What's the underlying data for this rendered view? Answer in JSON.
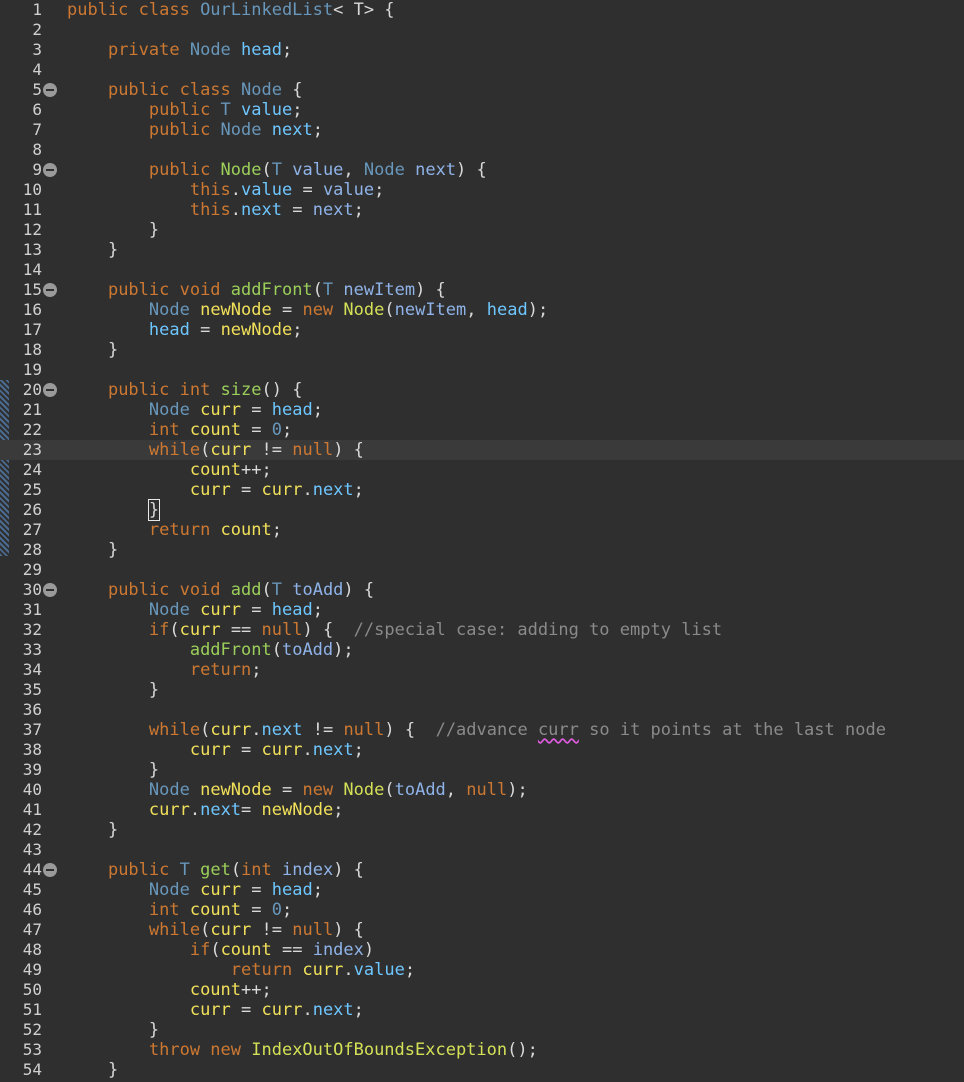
{
  "colors": {
    "background": "#2f2f2f",
    "current_line": "#3a3a3a",
    "keyword": "#cc7832",
    "type": "#6897bb",
    "field": "#6ec6ff",
    "local_var": "#f1e05a",
    "parameter": "#8fb3e8",
    "method": "#9bcf5a",
    "constructor_class": "#d4e157",
    "comment": "#8a8a8a",
    "plain": "#d9d9d9",
    "line_number": "#d0d0d0"
  },
  "icons": {
    "fold": "collapse-fold-icon",
    "change_bar": "change-marker"
  },
  "current_line": 23,
  "fold_lines": [
    5,
    9,
    15,
    20,
    30,
    44
  ],
  "lines": [
    {
      "n": "1",
      "t": [
        [
          "kw",
          "public class "
        ],
        [
          "ty",
          "OurLinkedList"
        ],
        [
          "pl",
          "< T> {"
        ]
      ]
    },
    {
      "n": "2",
      "t": []
    },
    {
      "n": "3",
      "t": [
        [
          "pl",
          "    "
        ],
        [
          "kw",
          "private "
        ],
        [
          "ty",
          "Node "
        ],
        [
          "fd",
          "head"
        ],
        [
          "pl",
          ";"
        ]
      ]
    },
    {
      "n": "4",
      "t": []
    },
    {
      "n": "5",
      "t": [
        [
          "pl",
          "    "
        ],
        [
          "kw",
          "public class "
        ],
        [
          "ty",
          "Node "
        ],
        [
          "pl",
          "{"
        ]
      ]
    },
    {
      "n": "6",
      "t": [
        [
          "pl",
          "        "
        ],
        [
          "kw",
          "public "
        ],
        [
          "ty",
          "T "
        ],
        [
          "fd",
          "value"
        ],
        [
          "pl",
          ";"
        ]
      ]
    },
    {
      "n": "7",
      "t": [
        [
          "pl",
          "        "
        ],
        [
          "kw",
          "public "
        ],
        [
          "ty",
          "Node "
        ],
        [
          "fd",
          "next"
        ],
        [
          "pl",
          ";"
        ]
      ]
    },
    {
      "n": "8",
      "t": []
    },
    {
      "n": "9",
      "t": [
        [
          "pl",
          "        "
        ],
        [
          "kw",
          "public "
        ],
        [
          "mt",
          "Node"
        ],
        [
          "pl",
          "("
        ],
        [
          "ty",
          "T "
        ],
        [
          "pa",
          "value"
        ],
        [
          "pl",
          ", "
        ],
        [
          "ty",
          "Node "
        ],
        [
          "pa",
          "next"
        ],
        [
          "pl",
          ") {"
        ]
      ]
    },
    {
      "n": "10",
      "t": [
        [
          "pl",
          "            "
        ],
        [
          "kw",
          "this"
        ],
        [
          "pl",
          "."
        ],
        [
          "fd",
          "value"
        ],
        [
          "pl",
          " = "
        ],
        [
          "pa",
          "value"
        ],
        [
          "pl",
          ";"
        ]
      ]
    },
    {
      "n": "11",
      "t": [
        [
          "pl",
          "            "
        ],
        [
          "kw",
          "this"
        ],
        [
          "pl",
          "."
        ],
        [
          "fd",
          "next"
        ],
        [
          "pl",
          " = "
        ],
        [
          "pa",
          "next"
        ],
        [
          "pl",
          ";"
        ]
      ]
    },
    {
      "n": "12",
      "t": [
        [
          "pl",
          "        }"
        ]
      ]
    },
    {
      "n": "13",
      "t": [
        [
          "pl",
          "    }"
        ]
      ]
    },
    {
      "n": "14",
      "t": []
    },
    {
      "n": "15",
      "t": [
        [
          "pl",
          "    "
        ],
        [
          "kw",
          "public void "
        ],
        [
          "mt",
          "addFront"
        ],
        [
          "pl",
          "("
        ],
        [
          "ty",
          "T "
        ],
        [
          "pa",
          "newItem"
        ],
        [
          "pl",
          ") {"
        ]
      ]
    },
    {
      "n": "16",
      "t": [
        [
          "pl",
          "        "
        ],
        [
          "ty",
          "Node "
        ],
        [
          "lv",
          "newNode"
        ],
        [
          "pl",
          " = "
        ],
        [
          "kw",
          "new "
        ],
        [
          "cl",
          "Node"
        ],
        [
          "pl",
          "("
        ],
        [
          "pa",
          "newItem"
        ],
        [
          "pl",
          ", "
        ],
        [
          "fd",
          "head"
        ],
        [
          "pl",
          ");"
        ]
      ]
    },
    {
      "n": "17",
      "t": [
        [
          "pl",
          "        "
        ],
        [
          "fd",
          "head"
        ],
        [
          "pl",
          " = "
        ],
        [
          "lv",
          "newNode"
        ],
        [
          "pl",
          ";"
        ]
      ]
    },
    {
      "n": "18",
      "t": [
        [
          "pl",
          "    }"
        ]
      ]
    },
    {
      "n": "19",
      "t": []
    },
    {
      "n": "20",
      "t": [
        [
          "pl",
          "    "
        ],
        [
          "kw",
          "public int "
        ],
        [
          "mt",
          "size"
        ],
        [
          "pl",
          "() {"
        ]
      ]
    },
    {
      "n": "21",
      "t": [
        [
          "pl",
          "        "
        ],
        [
          "ty",
          "Node "
        ],
        [
          "lv",
          "curr"
        ],
        [
          "pl",
          " = "
        ],
        [
          "fd",
          "head"
        ],
        [
          "pl",
          ";"
        ]
      ]
    },
    {
      "n": "22",
      "t": [
        [
          "pl",
          "        "
        ],
        [
          "kw",
          "int "
        ],
        [
          "lv",
          "count"
        ],
        [
          "pl",
          " = "
        ],
        [
          "nu",
          "0"
        ],
        [
          "pl",
          ";"
        ]
      ]
    },
    {
      "n": "23",
      "t": [
        [
          "pl",
          "        "
        ],
        [
          "kw",
          "while"
        ],
        [
          "pl",
          "("
        ],
        [
          "lv",
          "curr"
        ],
        [
          "pl",
          " != "
        ],
        [
          "kw",
          "null"
        ],
        [
          "pl",
          ") {"
        ]
      ]
    },
    {
      "n": "24",
      "t": [
        [
          "pl",
          "            "
        ],
        [
          "lv",
          "count"
        ],
        [
          "pl",
          "++;"
        ]
      ]
    },
    {
      "n": "25",
      "t": [
        [
          "pl",
          "            "
        ],
        [
          "lv",
          "curr"
        ],
        [
          "pl",
          " = "
        ],
        [
          "lv",
          "curr"
        ],
        [
          "pl",
          "."
        ],
        [
          "fd",
          "next"
        ],
        [
          "pl",
          ";"
        ]
      ]
    },
    {
      "n": "26",
      "t": [
        [
          "pl",
          "        "
        ],
        [
          "cursor-brace",
          "}"
        ]
      ]
    },
    {
      "n": "27",
      "t": [
        [
          "pl",
          "        "
        ],
        [
          "kw",
          "return "
        ],
        [
          "lv",
          "count"
        ],
        [
          "pl",
          ";"
        ]
      ]
    },
    {
      "n": "28",
      "t": [
        [
          "pl",
          "    }"
        ]
      ]
    },
    {
      "n": "29",
      "t": []
    },
    {
      "n": "30",
      "t": [
        [
          "pl",
          "    "
        ],
        [
          "kw",
          "public void "
        ],
        [
          "mt",
          "add"
        ],
        [
          "pl",
          "("
        ],
        [
          "ty",
          "T "
        ],
        [
          "pa",
          "toAdd"
        ],
        [
          "pl",
          ") {"
        ]
      ]
    },
    {
      "n": "31",
      "t": [
        [
          "pl",
          "        "
        ],
        [
          "ty",
          "Node "
        ],
        [
          "lv",
          "curr"
        ],
        [
          "pl",
          " = "
        ],
        [
          "fd",
          "head"
        ],
        [
          "pl",
          ";"
        ]
      ]
    },
    {
      "n": "32",
      "t": [
        [
          "pl",
          "        "
        ],
        [
          "kw",
          "if"
        ],
        [
          "pl",
          "("
        ],
        [
          "lv",
          "curr"
        ],
        [
          "pl",
          " == "
        ],
        [
          "kw",
          "null"
        ],
        [
          "pl",
          ") {  "
        ],
        [
          "cm",
          "//special case: adding to empty list"
        ]
      ]
    },
    {
      "n": "33",
      "t": [
        [
          "pl",
          "            "
        ],
        [
          "mt",
          "addFront"
        ],
        [
          "pl",
          "("
        ],
        [
          "pa",
          "toAdd"
        ],
        [
          "pl",
          ");"
        ]
      ]
    },
    {
      "n": "34",
      "t": [
        [
          "pl",
          "            "
        ],
        [
          "kw",
          "return"
        ],
        [
          "pl",
          ";"
        ]
      ]
    },
    {
      "n": "35",
      "t": [
        [
          "pl",
          "        }"
        ]
      ]
    },
    {
      "n": "36",
      "t": []
    },
    {
      "n": "37",
      "t": [
        [
          "pl",
          "        "
        ],
        [
          "kw",
          "while"
        ],
        [
          "pl",
          "("
        ],
        [
          "lv",
          "curr"
        ],
        [
          "pl",
          "."
        ],
        [
          "fd",
          "next"
        ],
        [
          "pl",
          " != "
        ],
        [
          "kw",
          "null"
        ],
        [
          "pl",
          ") {  "
        ],
        [
          "cm",
          "//advance "
        ],
        [
          "cm sq",
          "curr"
        ],
        [
          "cm",
          " so it points at the last node"
        ]
      ]
    },
    {
      "n": "38",
      "t": [
        [
          "pl",
          "            "
        ],
        [
          "lv",
          "curr"
        ],
        [
          "pl",
          " = "
        ],
        [
          "lv",
          "curr"
        ],
        [
          "pl",
          "."
        ],
        [
          "fd",
          "next"
        ],
        [
          "pl",
          ";"
        ]
      ]
    },
    {
      "n": "39",
      "t": [
        [
          "pl",
          "        }"
        ]
      ]
    },
    {
      "n": "40",
      "t": [
        [
          "pl",
          "        "
        ],
        [
          "ty",
          "Node "
        ],
        [
          "lv",
          "newNode"
        ],
        [
          "pl",
          " = "
        ],
        [
          "kw",
          "new "
        ],
        [
          "cl",
          "Node"
        ],
        [
          "pl",
          "("
        ],
        [
          "pa",
          "toAdd"
        ],
        [
          "pl",
          ", "
        ],
        [
          "kw",
          "null"
        ],
        [
          "pl",
          ");"
        ]
      ]
    },
    {
      "n": "41",
      "t": [
        [
          "pl",
          "        "
        ],
        [
          "lv",
          "curr"
        ],
        [
          "pl",
          "."
        ],
        [
          "fd",
          "next"
        ],
        [
          "pl",
          "= "
        ],
        [
          "lv",
          "newNode"
        ],
        [
          "pl",
          ";"
        ]
      ]
    },
    {
      "n": "42",
      "t": [
        [
          "pl",
          "    }"
        ]
      ]
    },
    {
      "n": "43",
      "t": []
    },
    {
      "n": "44",
      "t": [
        [
          "pl",
          "    "
        ],
        [
          "kw",
          "public "
        ],
        [
          "ty",
          "T "
        ],
        [
          "mt",
          "get"
        ],
        [
          "pl",
          "("
        ],
        [
          "kw",
          "int "
        ],
        [
          "pa",
          "index"
        ],
        [
          "pl",
          ") {"
        ]
      ]
    },
    {
      "n": "45",
      "t": [
        [
          "pl",
          "        "
        ],
        [
          "ty",
          "Node "
        ],
        [
          "lv",
          "curr"
        ],
        [
          "pl",
          " = "
        ],
        [
          "fd",
          "head"
        ],
        [
          "pl",
          ";"
        ]
      ]
    },
    {
      "n": "46",
      "t": [
        [
          "pl",
          "        "
        ],
        [
          "kw",
          "int "
        ],
        [
          "lv",
          "count"
        ],
        [
          "pl",
          " = "
        ],
        [
          "nu",
          "0"
        ],
        [
          "pl",
          ";"
        ]
      ]
    },
    {
      "n": "47",
      "t": [
        [
          "pl",
          "        "
        ],
        [
          "kw",
          "while"
        ],
        [
          "pl",
          "("
        ],
        [
          "lv",
          "curr"
        ],
        [
          "pl",
          " != "
        ],
        [
          "kw",
          "null"
        ],
        [
          "pl",
          ") {"
        ]
      ]
    },
    {
      "n": "48",
      "t": [
        [
          "pl",
          "            "
        ],
        [
          "kw",
          "if"
        ],
        [
          "pl",
          "("
        ],
        [
          "lv",
          "count"
        ],
        [
          "pl",
          " == "
        ],
        [
          "pa",
          "index"
        ],
        [
          "pl",
          ")"
        ]
      ]
    },
    {
      "n": "49",
      "t": [
        [
          "pl",
          "                "
        ],
        [
          "kw",
          "return "
        ],
        [
          "lv",
          "curr"
        ],
        [
          "pl",
          "."
        ],
        [
          "fd",
          "value"
        ],
        [
          "pl",
          ";"
        ]
      ]
    },
    {
      "n": "50",
      "t": [
        [
          "pl",
          "            "
        ],
        [
          "lv",
          "count"
        ],
        [
          "pl",
          "++;"
        ]
      ]
    },
    {
      "n": "51",
      "t": [
        [
          "pl",
          "            "
        ],
        [
          "lv",
          "curr"
        ],
        [
          "pl",
          " = "
        ],
        [
          "lv",
          "curr"
        ],
        [
          "pl",
          "."
        ],
        [
          "fd",
          "next"
        ],
        [
          "pl",
          ";"
        ]
      ]
    },
    {
      "n": "52",
      "t": [
        [
          "pl",
          "        }"
        ]
      ]
    },
    {
      "n": "53",
      "t": [
        [
          "pl",
          "        "
        ],
        [
          "kw",
          "throw new "
        ],
        [
          "cl",
          "IndexOutOfBoundsException"
        ],
        [
          "pl",
          "();"
        ]
      ]
    },
    {
      "n": "54",
      "t": [
        [
          "pl",
          "    }"
        ]
      ]
    }
  ]
}
